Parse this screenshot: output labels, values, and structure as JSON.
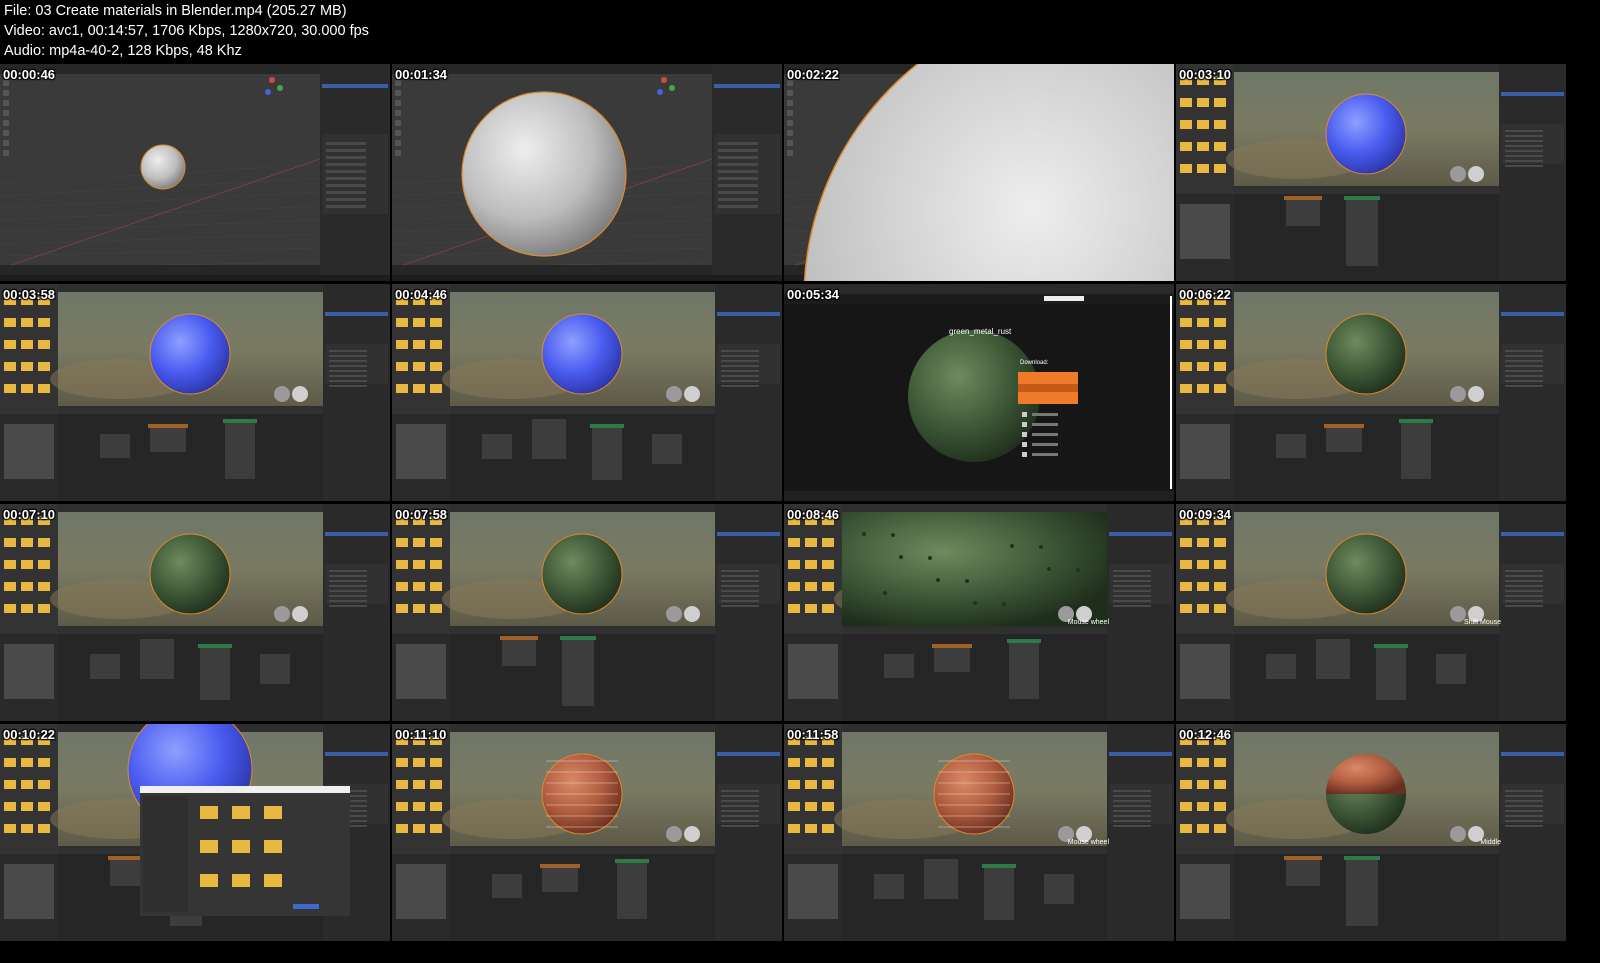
{
  "header": {
    "file_line": "File: 03  Create materials in Blender.mp4 (205.27 MB)",
    "video_line": "Video: avc1, 00:14:57, 1706 Kbps, 1280x720, 30.000 fps",
    "audio_line": "Audio: mp4a-40-2, 128 Kbps, 48 Khz"
  },
  "colors": {
    "background": "#000000",
    "blender_ui": "#2b2b2b",
    "selection_outline": "#e08a2a",
    "material_blue": "#4a5cf0",
    "material_green": "#3f5a38",
    "material_brick": "#b05c40",
    "download_orange": "#ee7a2a"
  },
  "frames": [
    {
      "timestamp": "00:00:46",
      "scene": "viewport",
      "sphere": "grey-small"
    },
    {
      "timestamp": "00:01:34",
      "scene": "viewport",
      "sphere": "grey-large"
    },
    {
      "timestamp": "00:02:22",
      "scene": "viewport",
      "sphere": "grey-closeup"
    },
    {
      "timestamp": "00:03:10",
      "scene": "shading",
      "sphere": "blue"
    },
    {
      "timestamp": "00:03:58",
      "scene": "shading",
      "sphere": "blue"
    },
    {
      "timestamp": "00:04:46",
      "scene": "shading",
      "sphere": "blue-glossy"
    },
    {
      "timestamp": "00:05:34",
      "scene": "browser",
      "sphere": "green",
      "texture_title": "green_metal_rust",
      "download_label": "Download:"
    },
    {
      "timestamp": "00:06:22",
      "scene": "shading",
      "sphere": "green"
    },
    {
      "timestamp": "00:07:10",
      "scene": "shading",
      "sphere": "green"
    },
    {
      "timestamp": "00:07:58",
      "scene": "shading",
      "sphere": "green"
    },
    {
      "timestamp": "00:08:46",
      "scene": "shading",
      "sphere": "green-closeup",
      "overlay_text": "Mouse wheel"
    },
    {
      "timestamp": "00:09:34",
      "scene": "shading",
      "sphere": "green",
      "overlay_text": "Shift Mouse"
    },
    {
      "timestamp": "00:10:22",
      "scene": "shading-dialog",
      "sphere": "blue"
    },
    {
      "timestamp": "00:11:10",
      "scene": "shading",
      "sphere": "brick"
    },
    {
      "timestamp": "00:11:58",
      "scene": "shading",
      "sphere": "brick",
      "overlay_text": "Mouse wheel"
    },
    {
      "timestamp": "00:12:46",
      "scene": "shading",
      "sphere": "brick-half",
      "overlay_text": "Middle"
    }
  ]
}
